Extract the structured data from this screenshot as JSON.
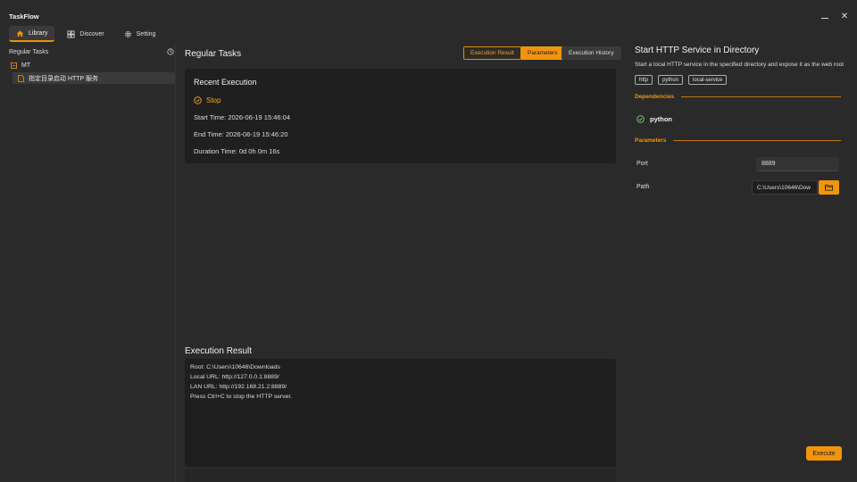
{
  "app": {
    "title": "TaskFlow"
  },
  "window": {
    "minimize_icon": "minimize-icon",
    "close_icon": "close-icon"
  },
  "nav": {
    "tabs": [
      {
        "label": "Library",
        "icon": "home-icon",
        "active": true
      },
      {
        "label": "Discover",
        "icon": "grid-icon",
        "active": false
      },
      {
        "label": "Setting",
        "icon": "gear-icon",
        "active": false
      }
    ]
  },
  "sidebar": {
    "header": "Regular Tasks",
    "root": {
      "label": "MT",
      "icon": "minus-box-icon"
    },
    "items": [
      {
        "label": "指定目录启动 HTTP 服务",
        "icon": "file-icon"
      }
    ]
  },
  "main": {
    "title": "Regular Tasks",
    "segments": {
      "result": "Execution Result",
      "params": "Parameters",
      "history": "Execution History"
    },
    "recent": {
      "title": "Recent Execution",
      "stop_label": "Stop",
      "start": "Start Time: 2026-06-19 15:46:04",
      "end": "End Time: 2026-06-19 15:46:20",
      "duration": "Duration Time: 0d 0h 0m 16s"
    },
    "result_title": "Execution Result",
    "console_lines": [
      "Root: C:\\Users\\10646\\Downloads",
      "Local URL: http://127.0.0.1:8889/",
      "LAN URL: http://192.168.21.2:8889/",
      "Press Ctrl+C to stop the HTTP server."
    ]
  },
  "detail": {
    "title": "Start HTTP Service in Directory",
    "description": "Start a local HTTP service in the specified directory and expose it as the web root",
    "tags": [
      "http",
      "python",
      "local-service"
    ],
    "dependencies_label": "Dependencies",
    "dependencies": [
      "python"
    ],
    "parameters_label": "Parameters",
    "port_label": "Port",
    "port_value": "8889",
    "path_label": "Path",
    "path_value": "C:\\Users\\10646\\Dow",
    "execute_label": "Execute"
  },
  "colors": {
    "accent": "#f2940c",
    "background": "#2a2a2a",
    "card": "#1f1f1f"
  }
}
